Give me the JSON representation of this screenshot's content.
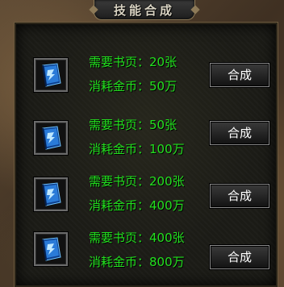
{
  "window": {
    "title": "技能合成"
  },
  "rows": [
    {
      "icon": "blue-skill-book-icon",
      "pages_label": "需要书页：",
      "pages_value": "20张",
      "cost_label": "消耗金币：",
      "cost_value": "50万",
      "button_label": "合成"
    },
    {
      "icon": "blue-skill-book-icon",
      "pages_label": "需要书页：",
      "pages_value": "50张",
      "cost_label": "消耗金币：",
      "cost_value": "100万",
      "button_label": "合成"
    },
    {
      "icon": "blue-skill-book-icon",
      "pages_label": "需要书页：",
      "pages_value": "200张",
      "cost_label": "消耗金币：",
      "cost_value": "400万",
      "button_label": "合成"
    },
    {
      "icon": "blue-skill-book-icon",
      "pages_label": "需要书页：",
      "pages_value": "400张",
      "cost_label": "消耗金币：",
      "cost_value": "800万",
      "button_label": "合成"
    }
  ],
  "colors": {
    "text_green": "#22e01e",
    "book_blue": "#2a7bd8"
  }
}
